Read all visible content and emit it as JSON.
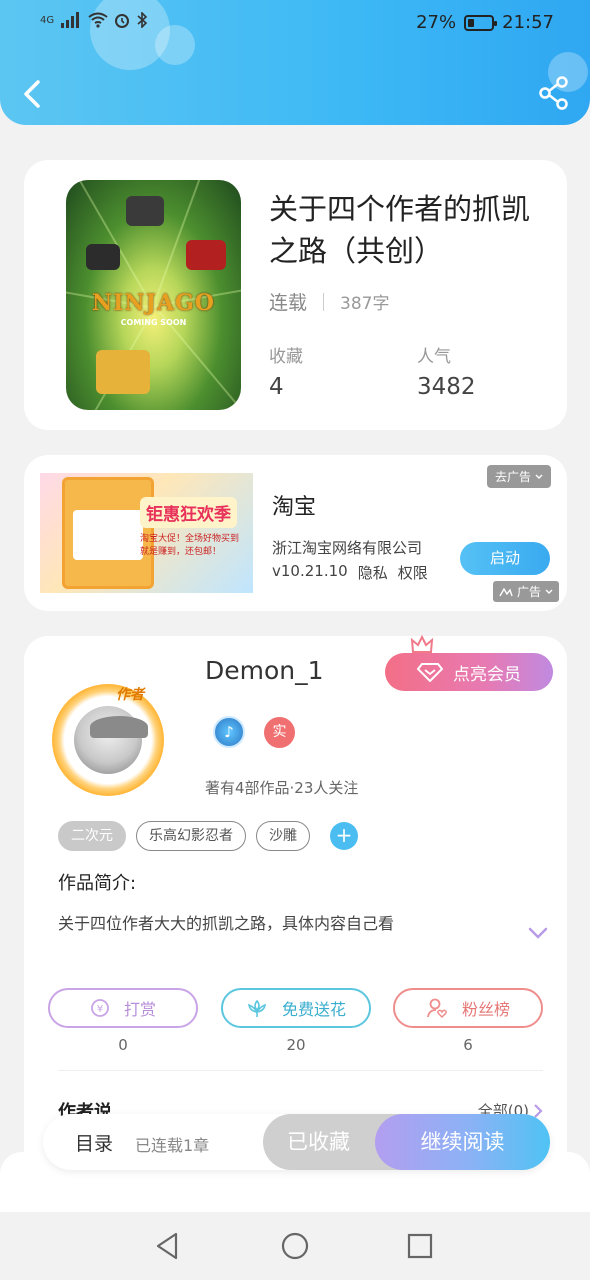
{
  "status_bar": {
    "network": "4G",
    "battery_pct": "27%",
    "battery_level": 0.27,
    "time": "21:57"
  },
  "header": {
    "back_icon": "chevron-left-icon",
    "share_icon": "share-icon"
  },
  "book": {
    "cover_text": "NINJAGO",
    "cover_sub": "COMING SOON",
    "title": "关于四个作者的抓凯之路（共创）",
    "status": "连载",
    "words": "387字",
    "favorites_label": "收藏",
    "favorites_value": "4",
    "popularity_label": "人气",
    "popularity_value": "3482"
  },
  "ad": {
    "image_banner": "钜惠狂欢季",
    "image_sub": "淘宝大促！全场好物买到就是赚到，还包邮！",
    "app_name": "淘宝",
    "company": "浙江淘宝网络有限公司",
    "version": "v10.21.10",
    "privacy": "隐私",
    "permissions": "权限",
    "close_ad": "去广告",
    "launch": "启动",
    "ad_label": "广告"
  },
  "author": {
    "badge_tag": "作者",
    "name": "Demon_1",
    "vip_button": "点亮会员",
    "real_badge": "实",
    "meta": "著有4部作品·23人关注",
    "tags": [
      "二次元",
      "乐高幻影忍者",
      "沙雕"
    ],
    "intro_label": "作品简介:",
    "intro_text": "关于四位作者大大的抓凯之路，具体内容自己看",
    "actions": [
      {
        "label": "打赏",
        "count": "0",
        "color": "#c9a4e6",
        "text_color": "#b78ed9"
      },
      {
        "label": "免费送花",
        "count": "20",
        "color": "#5cc6df",
        "text_color": "#3aaecf"
      },
      {
        "label": "粉丝榜",
        "count": "6",
        "color": "#ef8d8d",
        "text_color": "#e67777"
      }
    ],
    "author_says": "作者说",
    "all_link": "全部(0)"
  },
  "bottom_bar": {
    "toc": "目录",
    "toc_info": "已连载1章",
    "collected": "已收藏",
    "continue_reading": "继续阅读"
  },
  "nav": {
    "back": "nav-back-icon",
    "home": "nav-home-icon",
    "recent": "nav-recent-icon"
  }
}
